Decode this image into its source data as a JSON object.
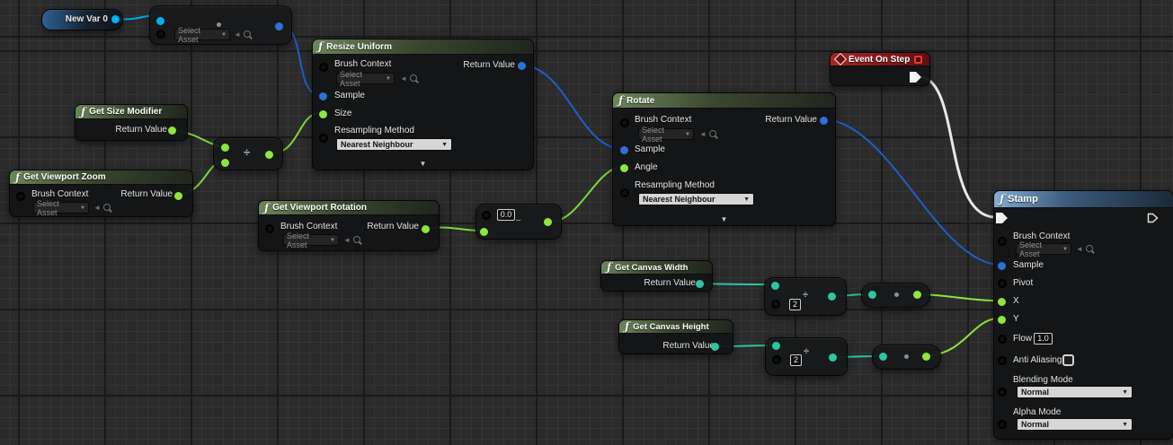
{
  "colors": {
    "exec_wire": "#e8e8e8",
    "object_wire": "#1d5fc8",
    "float_wire": "#7fd83a",
    "int_wire": "#2cc7a2",
    "var_wire": "#00a9e8",
    "function_header": "#6d865b",
    "event_header": "#a82525",
    "stamp_header": "#85aed4"
  },
  "nodes": {
    "new_var": {
      "label": "New Var 0"
    },
    "asset_picker": {
      "select_asset": "Select Asset"
    },
    "resize_uniform": {
      "title": "Resize Uniform",
      "brush_context_label": "Brush Context",
      "select_asset": "Select Asset",
      "sample_label": "Sample",
      "size_label": "Size",
      "resampling_label": "Resampling Method",
      "resampling_value": "Nearest Neighbour",
      "return_label": "Return Value"
    },
    "get_size_modifier": {
      "title": "Get Size Modifier",
      "return_label": "Return Value"
    },
    "get_viewport_zoom": {
      "title": "Get Viewport Zoom",
      "brush_context_label": "Brush Context",
      "select_asset": "Select Asset",
      "return_label": "Return Value"
    },
    "get_viewport_rotation": {
      "title": "Get Viewport Rotation",
      "brush_context_label": "Brush Context",
      "select_asset": "Select Asset",
      "return_label": "Return Value"
    },
    "divide": {
      "operator": "÷"
    },
    "subtract": {
      "value": "0.0",
      "operator": "–"
    },
    "rotate": {
      "title": "Rotate",
      "brush_context_label": "Brush Context",
      "select_asset": "Select Asset",
      "sample_label": "Sample",
      "angle_label": "Angle",
      "resampling_label": "Resampling Method",
      "resampling_value": "Nearest Neighbour",
      "return_label": "Return Value"
    },
    "event_on_step": {
      "title": "Event On Step"
    },
    "get_canvas_width": {
      "title": "Get Canvas Width",
      "return_label": "Return Value"
    },
    "get_canvas_height": {
      "title": "Get Canvas Height",
      "return_label": "Return Value"
    },
    "divide_width": {
      "value": "2",
      "operator": "÷"
    },
    "divide_height": {
      "value": "2",
      "operator": "÷"
    },
    "multiply_width": {
      "operator": "•"
    },
    "multiply_height": {
      "operator": "•"
    },
    "stamp": {
      "title": "Stamp",
      "brush_context_label": "Brush Context",
      "select_asset": "Select Asset",
      "sample_label": "Sample",
      "pivot_label": "Pivot",
      "x_label": "X",
      "y_label": "Y",
      "flow_label": "Flow",
      "flow_value": "1.0",
      "anti_aliasing_label": "Anti Aliasing",
      "blending_label": "Blending Mode",
      "blending_value": "Normal",
      "alpha_label": "Alpha Mode",
      "alpha_value": "Normal"
    }
  }
}
